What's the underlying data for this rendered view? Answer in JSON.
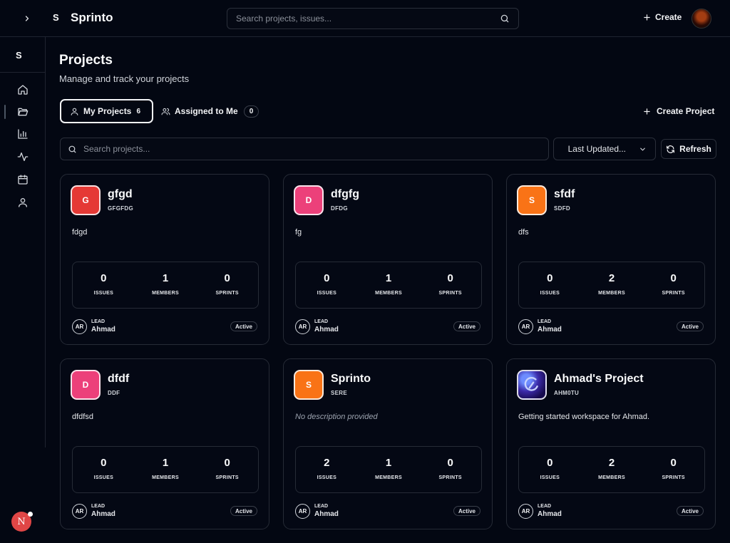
{
  "topbar": {
    "brand_mark": "S",
    "brand_name": "Sprinto",
    "search_placeholder": "Search projects, issues...",
    "create_label": "Create"
  },
  "sidebar": {
    "brand_mark": "S",
    "items": [
      {
        "name": "home",
        "icon": "home-icon"
      },
      {
        "name": "projects",
        "icon": "folder-icon",
        "active": true
      },
      {
        "name": "reports",
        "icon": "bar-chart-icon"
      },
      {
        "name": "activity",
        "icon": "activity-icon"
      },
      {
        "name": "calendar",
        "icon": "calendar-icon"
      },
      {
        "name": "profile",
        "icon": "user-icon"
      }
    ],
    "notification_initial": "N"
  },
  "page": {
    "title": "Projects",
    "subtitle": "Manage and track your projects"
  },
  "tabs": [
    {
      "label": "My Projects",
      "count": "6",
      "active": true
    },
    {
      "label": "Assigned to Me",
      "count": "0",
      "active": false
    }
  ],
  "create_project_label": "Create Project",
  "toolbar": {
    "search_placeholder": "Search projects...",
    "sort_value": "Last Updated...",
    "refresh_label": "Refresh"
  },
  "labels": {
    "issues": "ISSUES",
    "members": "MEMBERS",
    "sprints": "SPRINTS",
    "lead": "LEAD"
  },
  "projects": [
    {
      "initial": "G",
      "name": "gfgd",
      "key": "GFGFDG",
      "description": "fdgd",
      "issues": "0",
      "members": "1",
      "sprints": "0",
      "lead_initials": "AR",
      "lead_name": "Ahmad",
      "status": "Active",
      "color": "#e53935"
    },
    {
      "initial": "D",
      "name": "dfgfg",
      "key": "DFDG",
      "description": "fg",
      "issues": "0",
      "members": "1",
      "sprints": "0",
      "lead_initials": "AR",
      "lead_name": "Ahmad",
      "status": "Active",
      "color": "#ec407a"
    },
    {
      "initial": "S",
      "name": "sfdf",
      "key": "SDFD",
      "description": "dfs",
      "issues": "0",
      "members": "2",
      "sprints": "0",
      "lead_initials": "AR",
      "lead_name": "Ahmad",
      "status": "Active",
      "color": "#f97316"
    },
    {
      "initial": "D",
      "name": "dfdf",
      "key": "DDF",
      "description": "dfdfsd",
      "issues": "0",
      "members": "1",
      "sprints": "0",
      "lead_initials": "AR",
      "lead_name": "Ahmad",
      "status": "Active",
      "color": "#ec407a"
    },
    {
      "initial": "S",
      "name": "Sprinto",
      "key": "SERE",
      "description": "No description provided",
      "issues": "2",
      "members": "1",
      "sprints": "0",
      "lead_initials": "AR",
      "lead_name": "Ahmad",
      "status": "Active",
      "color": "#f97316"
    },
    {
      "initial": "",
      "name": "Ahmad's Project",
      "key": "AHM0TU",
      "description": "Getting started workspace for Ahmad.",
      "issues": "0",
      "members": "2",
      "sprints": "0",
      "lead_initials": "AR",
      "lead_name": "Ahmad",
      "status": "Active",
      "color": "#3b2aa8"
    }
  ]
}
